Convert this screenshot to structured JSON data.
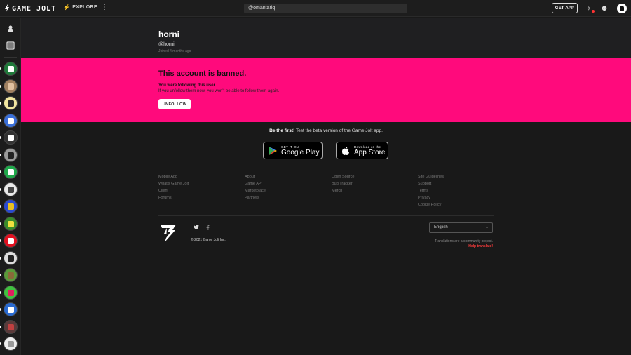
{
  "topbar": {
    "logo_text": "GAME JOLT",
    "explore_label": "EXPLORE",
    "search_value": "@omantariq",
    "get_app_label": "GET APP"
  },
  "sidebar": {
    "games": [
      {
        "color": "#1f7a3a",
        "accent": "#ffffff"
      },
      {
        "color": "#a08060",
        "accent": "#e0c0a0"
      },
      {
        "color": "#f2e6a0",
        "accent": "#2a2a2a"
      },
      {
        "color": "#3a6fd8",
        "accent": "#ffffff"
      },
      {
        "color": "#333333",
        "accent": "#ffffff"
      },
      {
        "color": "#9a9a9a",
        "accent": "#222222"
      },
      {
        "color": "#1fa84a",
        "accent": "#ffffff"
      },
      {
        "color": "#e8e8e8",
        "accent": "#444444"
      },
      {
        "color": "#2a4ad0",
        "accent": "#e8c020"
      },
      {
        "color": "#3a8a2a",
        "accent": "#f0e040"
      },
      {
        "color": "#e01020",
        "accent": "#ffffff"
      },
      {
        "color": "#dddddd",
        "accent": "#222222"
      },
      {
        "color": "#5a9a3a",
        "accent": "#8a6a3a"
      },
      {
        "color": "#40c040",
        "accent": "#e02060"
      },
      {
        "color": "#2a6ad0",
        "accent": "#ffffff"
      },
      {
        "color": "#5a3a3a",
        "accent": "#c04040"
      },
      {
        "color": "#eeeeee",
        "accent": "#999999"
      }
    ]
  },
  "profile": {
    "username": "horni",
    "handle": "@horni",
    "joined": "Joined 4 months ago"
  },
  "banned": {
    "title": "This account is banned.",
    "following_notice": "You were following this user.",
    "warning": "If you unfollow them now, you won't be able to follow them again.",
    "unfollow_label": "UNFOLLOW",
    "background_color": "#ff0a7c"
  },
  "footer": {
    "beta_bold": "Be the first!",
    "beta_rest": " Test the beta version of the Game Jolt app.",
    "google_play_small": "GET IT ON",
    "google_play_big": "Google Play",
    "app_store_small": "Download on the",
    "app_store_big": "App Store",
    "links_col1": [
      "Mobile App",
      "What's Game Jolt",
      "Client",
      "Forums"
    ],
    "links_col2": [
      "About",
      "Game API",
      "Marketplace",
      "Partners"
    ],
    "links_col3": [
      "Open Source",
      "Bug Tracker",
      "Merch"
    ],
    "links_col4": [
      "Site Guidelines",
      "Support",
      "Terms",
      "Privacy",
      "Cookie Policy"
    ],
    "copyright": "© 2021 Game Jolt Inc.",
    "language": "English",
    "translations_note": "Translations are a community project.",
    "help_translate": "Help translate!"
  }
}
